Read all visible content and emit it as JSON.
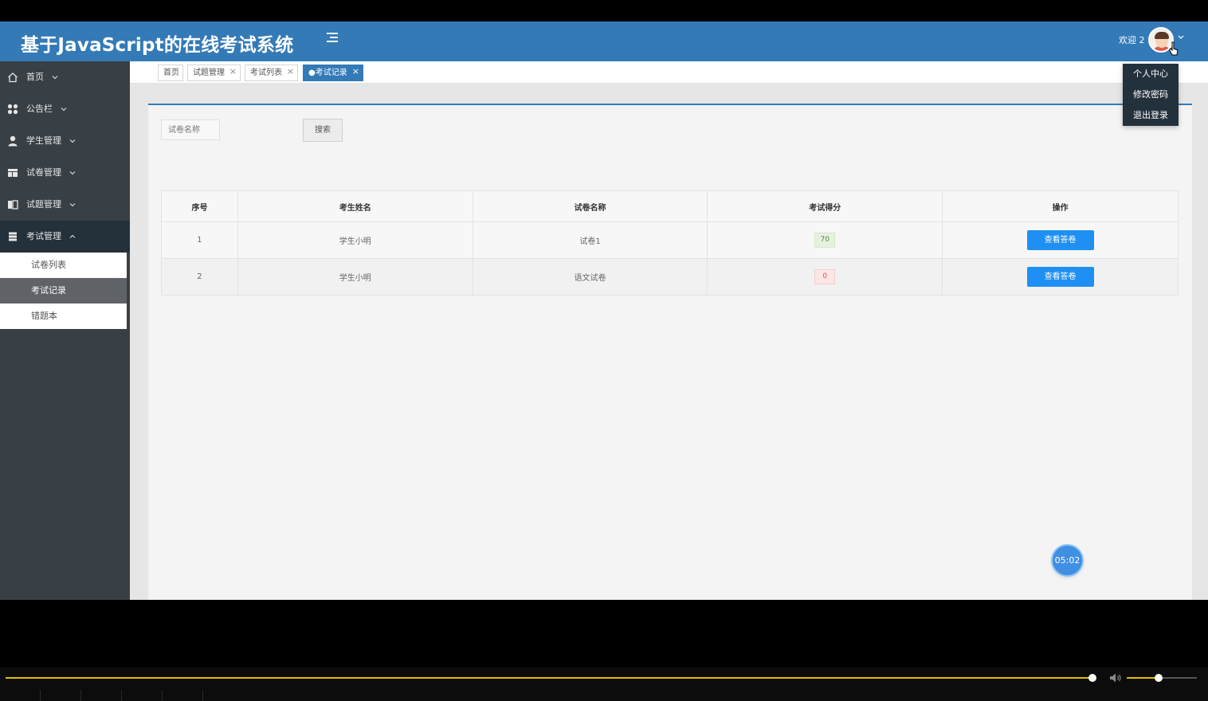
{
  "header": {
    "app_title": "基于JavaScript的在线考试系统",
    "welcome_text": "欢迎 2",
    "user_menu": [
      "个人中心",
      "修改密码",
      "退出登录"
    ]
  },
  "sidebar": {
    "items": [
      {
        "label": "首页",
        "icon": "home-icon"
      },
      {
        "label": "公告栏",
        "icon": "grid-icon"
      },
      {
        "label": "学生管理",
        "icon": "user-icon"
      },
      {
        "label": "试卷管理",
        "icon": "layout-icon"
      },
      {
        "label": "试题管理",
        "icon": "columns-icon"
      },
      {
        "label": "考试管理",
        "icon": "server-icon",
        "expanded": true
      }
    ],
    "subitems": [
      "试卷列表",
      "考试记录",
      "错题本"
    ],
    "active_subitem": "考试记录"
  },
  "tabs": [
    {
      "label": "首页",
      "closable": false,
      "active": false
    },
    {
      "label": "试题管理",
      "closable": true,
      "active": false
    },
    {
      "label": "考试列表",
      "closable": true,
      "active": false
    },
    {
      "label": "●考试记录",
      "closable": true,
      "active": true
    }
  ],
  "search": {
    "placeholder": "试卷名称",
    "button_label": "搜索"
  },
  "table": {
    "headers": [
      "序号",
      "考生姓名",
      "试卷名称",
      "考试得分",
      "操作"
    ],
    "rows": [
      {
        "index": "1",
        "student": "学生小明",
        "paper": "试卷1",
        "score": "70",
        "action": "查看答卷"
      },
      {
        "index": "2",
        "student": "学生小明",
        "paper": "语文试卷",
        "score": "0",
        "action": "查看答卷"
      }
    ]
  },
  "timer": "05:02",
  "player": {
    "progress": 0.997,
    "volume": 0.4,
    "accent_color": "#e4c100"
  },
  "colors": {
    "primary": "#337ab7",
    "sidebar": "#394045",
    "button": "#1e90f3"
  }
}
